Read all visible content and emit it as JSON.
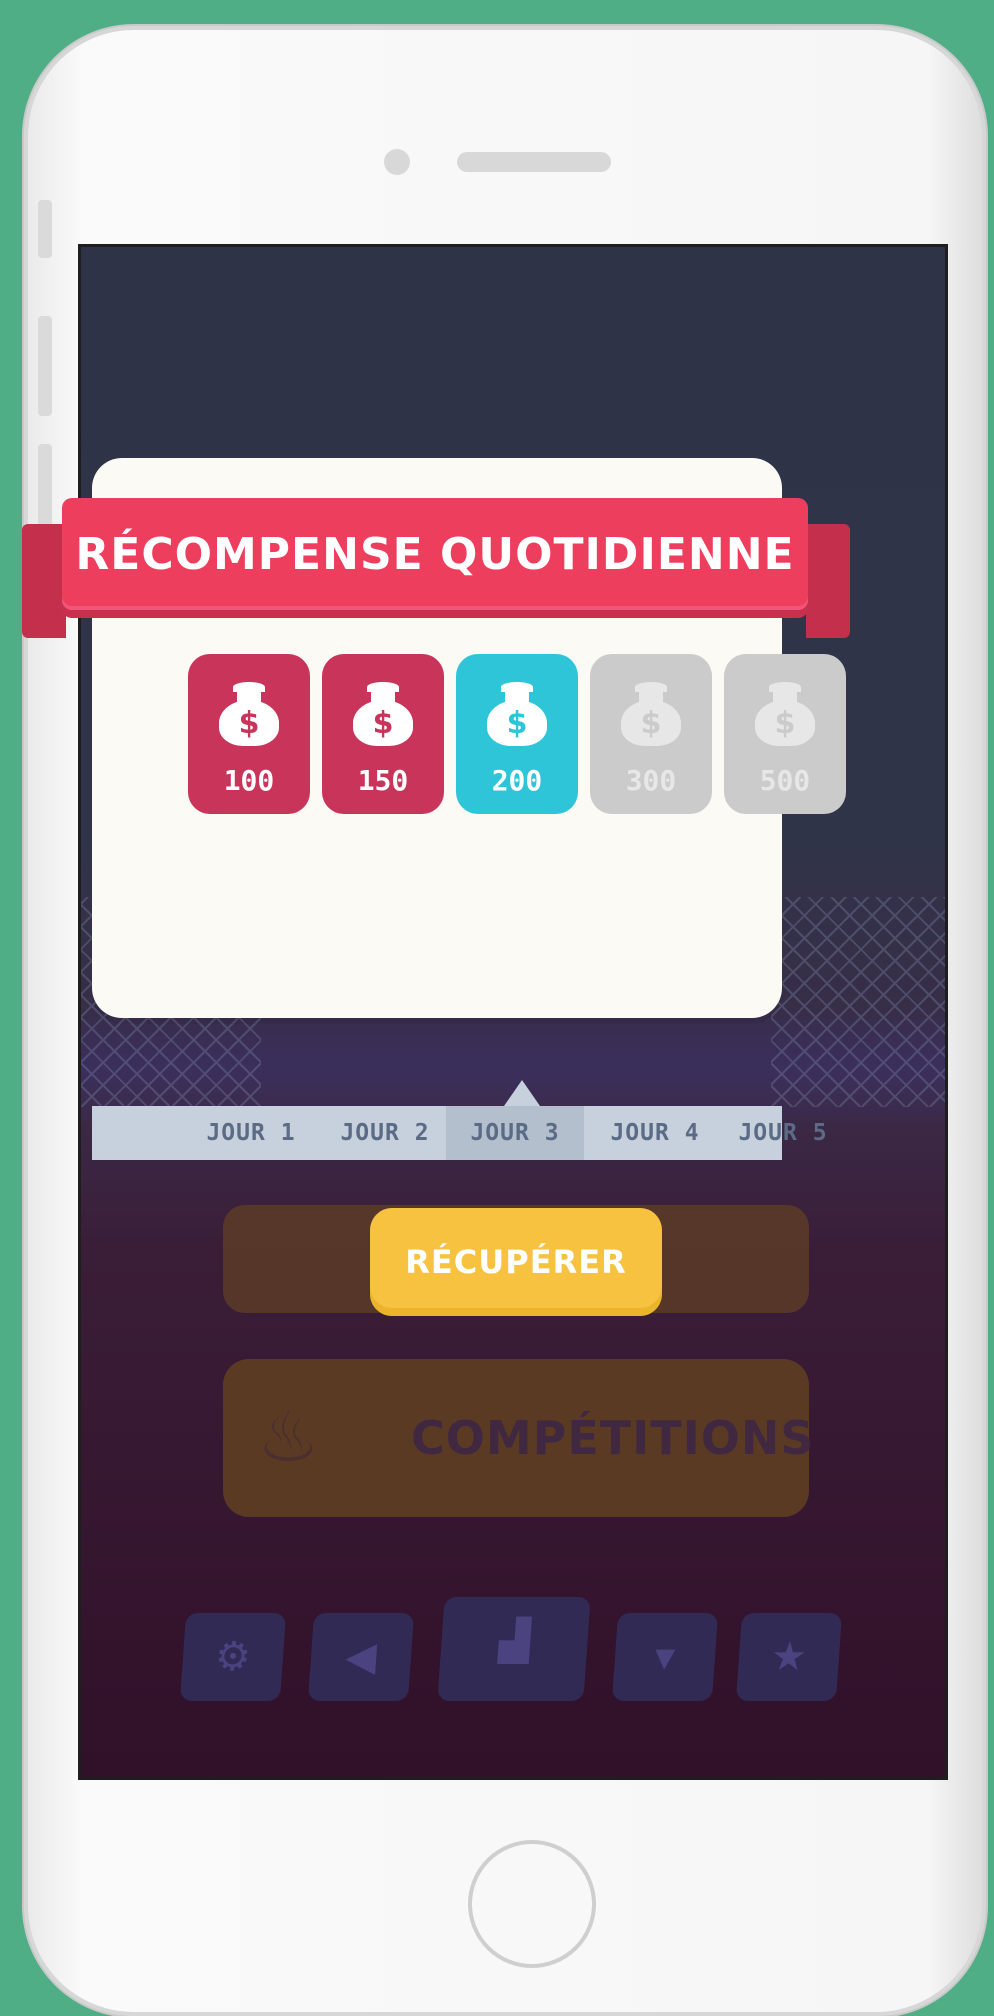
{
  "modal": {
    "title": "RÉCOMPENSE QUOTIDIENNE",
    "rewards": [
      {
        "amount": "100",
        "day": "JOUR 1",
        "state": "claimed"
      },
      {
        "amount": "150",
        "day": "JOUR 2",
        "state": "claimed"
      },
      {
        "amount": "200",
        "day": "JOUR 3",
        "state": "current"
      },
      {
        "amount": "300",
        "day": "JOUR 4",
        "state": "locked"
      },
      {
        "amount": "500",
        "day": "JOUR 5",
        "state": "locked"
      }
    ],
    "claim_label": "RÉCUPÉRER",
    "icon": "money-bag-icon"
  },
  "background": {
    "competitions_label": "COMPÉTITIONS",
    "bottom_icons": [
      "gear-icon",
      "speaker-icon",
      "podium-icon",
      "shirt-icon",
      "star-icon"
    ]
  },
  "colors": {
    "phone_bg": "#4fae86",
    "ribbon": "#ee3e5d",
    "claimed": "#c8345a",
    "current": "#2ec5d9",
    "locked": "#cbcbcb",
    "claim_button": "#f6c23f"
  }
}
